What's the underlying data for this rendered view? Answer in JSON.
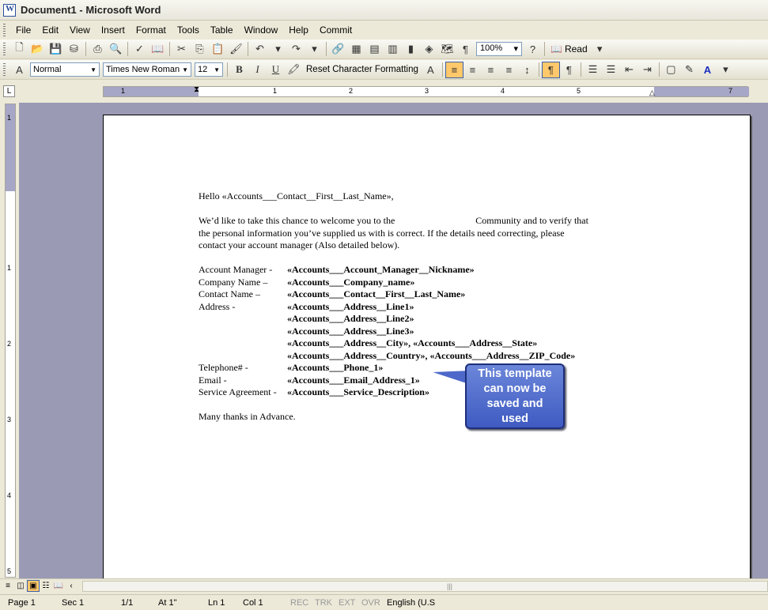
{
  "window": {
    "title": "Document1 - Microsoft Word"
  },
  "menu": [
    "File",
    "Edit",
    "View",
    "Insert",
    "Format",
    "Tools",
    "Table",
    "Window",
    "Help",
    "Commit"
  ],
  "toolbar": {
    "zoom": "100%",
    "read_label": "Read"
  },
  "format": {
    "style": "Normal",
    "font": "Times New Roman",
    "size": "12",
    "reset_label": "Reset Character Formatting"
  },
  "ruler": {
    "numbers": [
      "1",
      "1",
      "2",
      "3",
      "4",
      "5",
      "7"
    ]
  },
  "vruler": {
    "numbers": [
      "1",
      "1",
      "2",
      "3",
      "4",
      "5"
    ]
  },
  "document": {
    "greeting": "Hello «Accounts___Contact__First__Last_Name»,",
    "intro_part1": "We’d like to take this chance to welcome you to the",
    "intro_part2": "Community and to verify that",
    "intro_line2": "the personal information you’ve supplied us with is correct. If the details need correcting, please",
    "intro_line3": "contact your account manager (Also detailed below).",
    "fields": [
      {
        "label": "Account Manager -",
        "value": "«Accounts___Account_Manager__Nickname»"
      },
      {
        "label": "Company Name –",
        "value": "«Accounts___Company_name»"
      },
      {
        "label": "Contact Name –",
        "value": "«Accounts___Contact__First__Last_Name»"
      },
      {
        "label": "Address -",
        "value": "«Accounts___Address__Line1»"
      },
      {
        "label": "",
        "value": "«Accounts___Address__Line2»"
      },
      {
        "label": "",
        "value": "«Accounts___Address__Line3»"
      },
      {
        "label": "",
        "value": "«Accounts___Address__City», «Accounts___Address__State»"
      },
      {
        "label": "",
        "value": "«Accounts___Address__Country», «Accounts___Address__ZIP_Code»"
      },
      {
        "label": "Telephone# -",
        "value": "«Accounts___Phone_1»"
      },
      {
        "label": "Email -",
        "value": "«Accounts___Email_Address_1»"
      },
      {
        "label": "Service Agreement -",
        "value": "«Accounts___Service_Description»"
      }
    ],
    "closing": "Many thanks in Advance."
  },
  "callout": {
    "line1": "This template",
    "line2": "can now be",
    "line3": "saved and",
    "line4": "used"
  },
  "status": {
    "page": "Page 1",
    "sec": "Sec 1",
    "pages": "1/1",
    "at": "At 1\"",
    "ln": "Ln 1",
    "col": "Col 1",
    "rec": "REC",
    "trk": "TRK",
    "ext": "EXT",
    "ovr": "OVR",
    "lang": "English (U.S"
  },
  "colors": {
    "workspace": "#9a9ab5",
    "callout": "#4d68c9",
    "active_button": "#ffc86b"
  }
}
